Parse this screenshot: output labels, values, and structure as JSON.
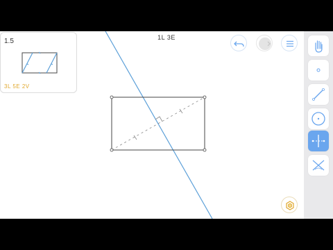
{
  "level": {
    "number": "1.5",
    "stars": "3L 5E 2V"
  },
  "goal": {
    "text": "1L 3E"
  },
  "header": {
    "undo_icon": "undo-icon",
    "redo_icon": "redo-icon",
    "menu_icon": "menu-icon"
  },
  "tools": [
    {
      "name": "hand-icon",
      "active": false
    },
    {
      "name": "point-icon",
      "active": false
    },
    {
      "name": "line-icon",
      "active": false
    },
    {
      "name": "circle-icon",
      "active": false
    },
    {
      "name": "perpendicular-bisector-icon",
      "active": true
    },
    {
      "name": "angle-bisector-icon",
      "active": false
    }
  ],
  "hint": {
    "icon": "hint-icon"
  },
  "colors": {
    "accent": "#6aa6ee",
    "construction_line": "#5b9fd8",
    "shape": "#444444",
    "stars": "#e0a82e",
    "toolbar": "#e9e9eb"
  }
}
